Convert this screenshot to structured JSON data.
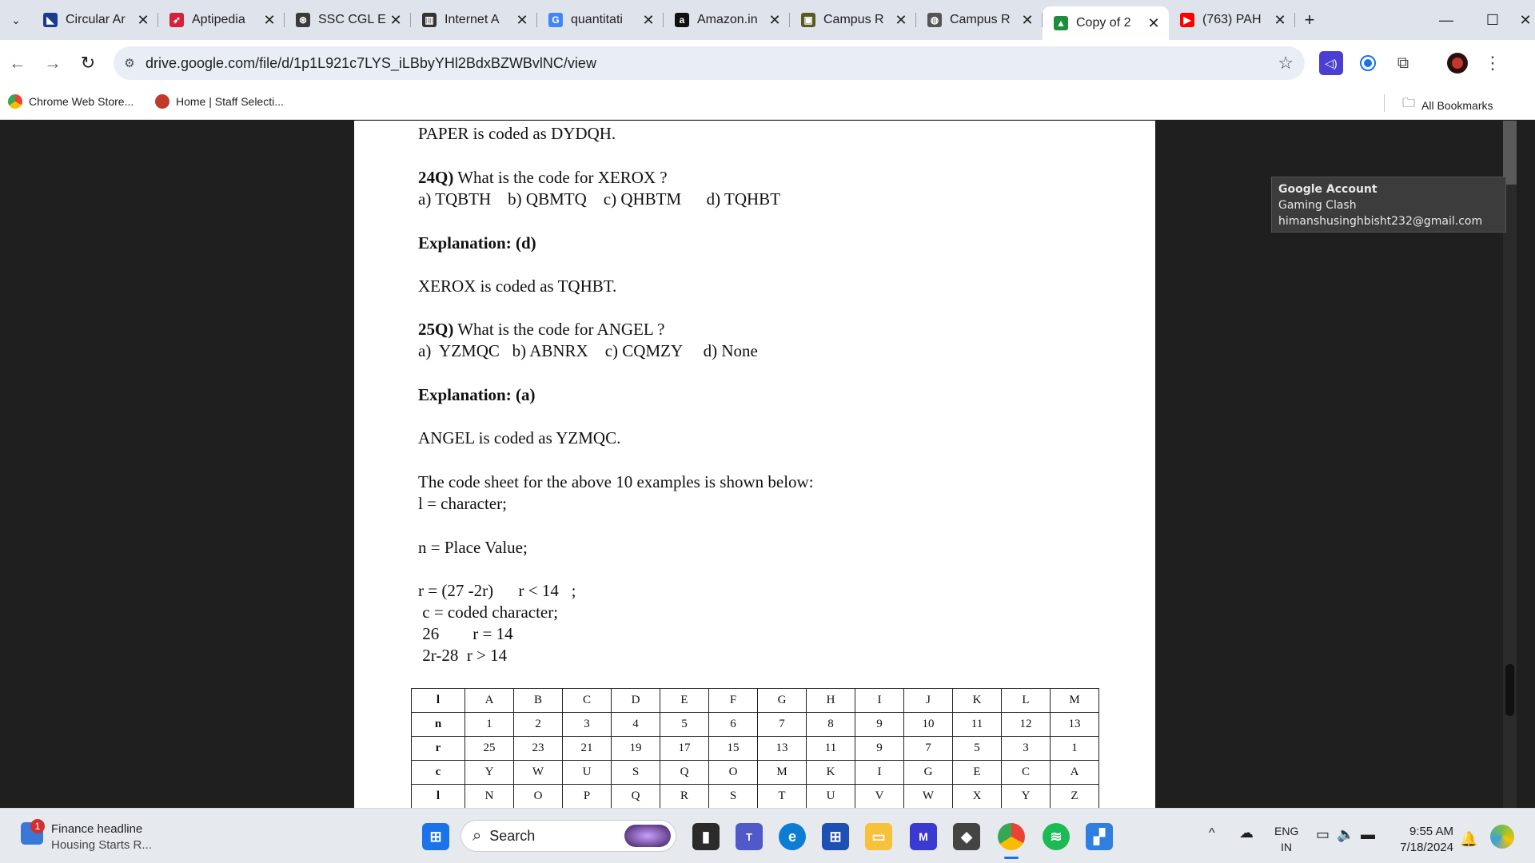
{
  "browser": {
    "tabs": [
      {
        "title": "Circular Ar",
        "fav_color": "#1a3c8c",
        "fav_glyph": "◣",
        "icon": "bookmark-blue-icon"
      },
      {
        "title": "Aptipedia",
        "fav_color": "#d6213a",
        "fav_glyph": "➶",
        "icon": "aptipedia-bird-icon"
      },
      {
        "title": "SSC CGL E",
        "fav_color": "#3a3a3a",
        "fav_glyph": "⊛",
        "icon": "chatgpt-icon"
      },
      {
        "title": "Internet A",
        "fav_color": "#333333",
        "fav_glyph": "▥",
        "icon": "internet-archive-icon"
      },
      {
        "title": "quantitati",
        "fav_color": "#4285f4",
        "fav_glyph": "G",
        "icon": "google-icon"
      },
      {
        "title": "Amazon.in",
        "fav_color": "#111111",
        "fav_glyph": "a",
        "icon": "amazon-icon"
      },
      {
        "title": "Campus R",
        "fav_color": "#5a5a20",
        "fav_glyph": "▣",
        "icon": "campus-icon"
      },
      {
        "title": "Campus R",
        "fav_color": "#555555",
        "fav_glyph": "◍",
        "icon": "globe-icon"
      },
      {
        "title": "Copy of 2",
        "fav_color": "#1e8e3e",
        "fav_glyph": "▲",
        "icon": "google-drive-icon",
        "active": true
      },
      {
        "title": "(763) PAH",
        "fav_color": "#ff0000",
        "fav_glyph": "▶",
        "icon": "youtube-icon"
      }
    ],
    "url": "drive.google.com/file/d/1p1L921c7LYS_iLBbyYHl2BdxBZWBvlNC/view",
    "bookmarks": [
      "Chrome Web Store...",
      "Home | Staff Selecti..."
    ],
    "all_bookmarks": "All Bookmarks"
  },
  "document": {
    "lines": [
      {
        "text": "PAPER is coded as DYDQH.",
        "bold": false
      },
      {
        "text": "24Q) What is the code for XEROX ?",
        "bold": false,
        "prefix_bold": "24Q)"
      },
      {
        "text": "a) TQBTH    b) QBMTQ    c) QHBTM      d) TQHBT",
        "bold": false
      },
      {
        "text": "Explanation: (d)",
        "bold": true
      },
      {
        "text": "XEROX is coded as TQHBT.",
        "bold": false
      },
      {
        "text": "25Q) What is the code for ANGEL ?",
        "bold": false,
        "prefix_bold": "25Q)"
      },
      {
        "text": "a)  YZMQC   b) ABNRX    c) CQMZY     d) None",
        "bold": false
      },
      {
        "text": "Explanation: (a)",
        "bold": true
      },
      {
        "text": "ANGEL is coded as YZMQC.",
        "bold": false
      },
      {
        "text": "The code sheet for the above 10 examples is shown below:",
        "bold": false
      },
      {
        "text": "l = character;",
        "bold": false
      },
      {
        "text": "n = Place Value;",
        "bold": false
      },
      {
        "text": "r = (27 -2r)      r < 14   ;",
        "bold": false
      },
      {
        "text": " c = coded character;",
        "bold": false
      },
      {
        "text": " 26        r = 14",
        "bold": false
      },
      {
        "text": " 2r-28  r > 14",
        "bold": false
      }
    ],
    "table": {
      "rows": [
        {
          "label": "l",
          "cells": [
            "A",
            "B",
            "C",
            "D",
            "E",
            "F",
            "G",
            "H",
            "I",
            "J",
            "K",
            "L",
            "M"
          ]
        },
        {
          "label": "n",
          "cells": [
            "1",
            "2",
            "3",
            "4",
            "5",
            "6",
            "7",
            "8",
            "9",
            "10",
            "11",
            "12",
            "13"
          ]
        },
        {
          "label": "r",
          "cells": [
            "25",
            "23",
            "21",
            "19",
            "17",
            "15",
            "13",
            "11",
            "9",
            "7",
            "5",
            "3",
            "1"
          ]
        },
        {
          "label": "c",
          "cells": [
            "Y",
            "W",
            "U",
            "S",
            "Q",
            "O",
            "M",
            "K",
            "I",
            "G",
            "E",
            "C",
            "A"
          ]
        },
        {
          "label": "l",
          "cells": [
            "N",
            "O",
            "P",
            "Q",
            "R",
            "S",
            "T",
            "U",
            "V",
            "W",
            "X",
            "Y",
            "Z"
          ]
        }
      ]
    }
  },
  "tooltip": {
    "title": "Google Account",
    "name": "Gaming Clash",
    "email": "himanshusinghbisht232@gmail.com"
  },
  "taskbar": {
    "news_badge": "1",
    "news_title": "Finance headline",
    "news_sub": "Housing Starts R...",
    "search_placeholder": "Search",
    "lang_top": "ENG",
    "lang_bottom": "IN",
    "time": "9:55 AM",
    "date": "7/18/2024"
  }
}
